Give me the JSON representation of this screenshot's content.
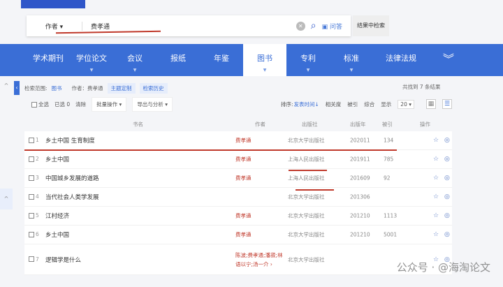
{
  "search": {
    "field": "作者",
    "value": "费孝通",
    "qa": "问答",
    "in_results": "结果中检索"
  },
  "nav": {
    "tabs": [
      "学术期刊",
      "学位论文",
      "会议",
      "报纸",
      "年鉴",
      "图书",
      "专利",
      "标准",
      "法律法规"
    ],
    "active": "图书"
  },
  "scope": {
    "label": "检索范围:",
    "value": "图书",
    "author": "作者：费孝通",
    "topic": "主题定制",
    "history": "检索历史"
  },
  "total": "共找到 7 条结果",
  "toolbar": {
    "select_all": "全选",
    "selected": "已选 0",
    "clear": "清除",
    "batch": "批量操作 ▾",
    "export": "导出与分析 ▾",
    "sort_label": "排序:",
    "sort_date": "发表时间↓",
    "sort_relevance": "相关度",
    "sort_cited": "被引",
    "sort_overall": "综合",
    "display": "显示",
    "page_size": "20 ▾"
  },
  "table": {
    "headers": {
      "title": "书名",
      "author": "作者",
      "publisher": "出版社",
      "year": "出版年",
      "cited": "被引",
      "ops": "操作"
    },
    "rows": [
      {
        "n": "1",
        "title": "乡土中国 生育制度",
        "author": "费孝通",
        "publisher": "北京大学出版社",
        "year": "202011",
        "cited": "134"
      },
      {
        "n": "2",
        "title": "乡土中国",
        "author": "费孝通",
        "publisher": "上海人民出版社",
        "year": "201911",
        "cited": "785"
      },
      {
        "n": "3",
        "title": "中国城乡发展的道路",
        "author": "费孝通",
        "publisher": "上海人民出版社",
        "year": "201609",
        "cited": "92"
      },
      {
        "n": "4",
        "title": "当代社会人类学发展",
        "author": "",
        "publisher": "北京大学出版社",
        "year": "201306",
        "cited": ""
      },
      {
        "n": "5",
        "title": "江村经济",
        "author": "费孝通",
        "publisher": "北京大学出版社",
        "year": "201210",
        "cited": "1113"
      },
      {
        "n": "6",
        "title": "乡土中国",
        "author": "费孝通",
        "publisher": "北京大学出版社",
        "year": "201210",
        "cited": "5001"
      },
      {
        "n": "7",
        "title": "逻辑学是什么",
        "author": "陈波;费孝通;潘菽;林语以宁;汤一介 ›",
        "publisher": "北京大学出版社",
        "year": "",
        "cited": ""
      }
    ]
  },
  "watermark": "公众号 · @海淘论文",
  "colors": {
    "brand": "#3a6ed6",
    "author": "#c0392b",
    "annotation": "#c0392b"
  }
}
